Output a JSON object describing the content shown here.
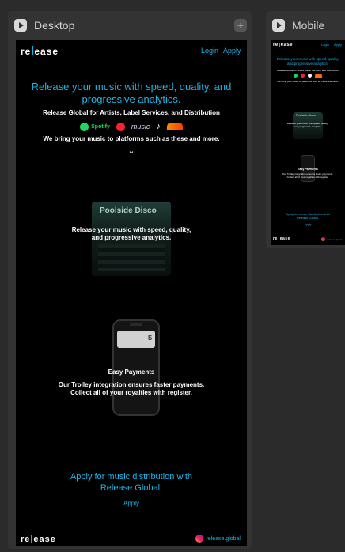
{
  "desktop_panel": {
    "title": "Desktop"
  },
  "mobile_panel": {
    "title": "Mobile"
  },
  "site": {
    "logo": "release",
    "nav": {
      "login": "Login",
      "apply": "Apply"
    },
    "hero": {
      "headline_line1": "Release your music with speed, quality, and",
      "headline_line2": "progressive analytics.",
      "subtitle": "Release Global for Artists, Label Services, and Distribution",
      "platforms": [
        "Spotify",
        "YouTube Music",
        "Apple Music",
        "TikTok",
        "SoundCloud"
      ],
      "platform_labels": {
        "spotify": "Spotify",
        "apple_music": "music"
      },
      "platforms_caption": "We bring your music to platforms such as these and more.",
      "scroll_indicator": "⌄"
    },
    "analytics_section": {
      "mock_title": "Poolside Disco",
      "text_line1": "Release your music with speed, quality,",
      "text_line2": "and progressive analytics."
    },
    "payments_section": {
      "title": "Easy Payments",
      "text_line1": "Our Trolley integration ensures faster payments.",
      "text_line2": "Collect all of your royalties with register.",
      "phone_amount": "$"
    },
    "cta": {
      "line1": "Apply for music distribution with",
      "line2": "Release Global.",
      "link": "Apply"
    },
    "footer": {
      "logo": "release",
      "instagram_handle": "release.global"
    }
  },
  "mobile_site": {
    "logo": "release",
    "nav": {
      "login": "Login",
      "apply": "Apply"
    },
    "headline_line1": "Release your music with speed, quality,",
    "headline_line2": "and progressive analytics.",
    "subtitle": "Release Global for Artists, Label Services, and Distribution",
    "platforms_caption": "We bring your music to platforms such as these and more.",
    "mock_title": "Poolside Disco",
    "analytics_text_line1": "Release your music with speed, quality,",
    "analytics_text_line2": "and progressive analytics.",
    "payments_title": "Easy Payments",
    "payments_text_line1": "Our Trolley integration ensures faster payments.",
    "payments_text_line2": "Collect all of your royalties with register.",
    "cta_line1": "Apply for music distribution with",
    "cta_line2": "Release Global.",
    "cta_link": "Apply",
    "footer_logo": "release",
    "instagram_handle": "release.global"
  },
  "colors": {
    "accent": "#1db4e6",
    "background": "#000000",
    "panel": "#333333"
  }
}
